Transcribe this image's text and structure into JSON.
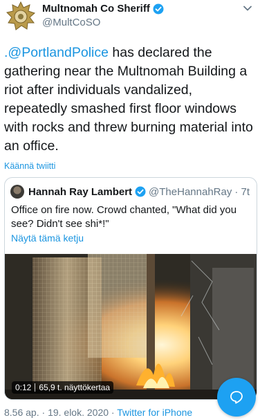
{
  "account": {
    "name": "Multnomah Co Sheriff",
    "handle": "@MultCoSO"
  },
  "tweet": {
    "mention": ".@PortlandPolice",
    "body": " has declared the gathering near the Multnomah Building a riot after individuals vandalized, repeatedly smashed first floor windows with rocks and threw burning material into an office.",
    "translate_label": "Käännä twiitti"
  },
  "quoted": {
    "name": "Hannah Ray Lambert",
    "handle": "@TheHannahRay",
    "time": "· 7t",
    "text": "Office on fire now. Crowd chanted, \"What did you see? Didn't see shi*!\"",
    "thread_label": "Näytä tämä ketju",
    "video_duration": "0:12",
    "video_views": "65,9 t. näyttökertaa"
  },
  "meta": {
    "time": "8.56 ap.",
    "sep1": " · ",
    "date": "19. elok. 2020",
    "sep2": " · ",
    "source": "Twitter for iPhone"
  },
  "colors": {
    "accent": "#1b95e0",
    "fab": "#1da1f2",
    "text": "#14171a",
    "muted": "#657786",
    "border": "#ccd6dd"
  },
  "icons": {
    "verified": "verified-badge-icon",
    "chevron": "chevron-down-icon",
    "compose": "compose-reply-icon"
  }
}
